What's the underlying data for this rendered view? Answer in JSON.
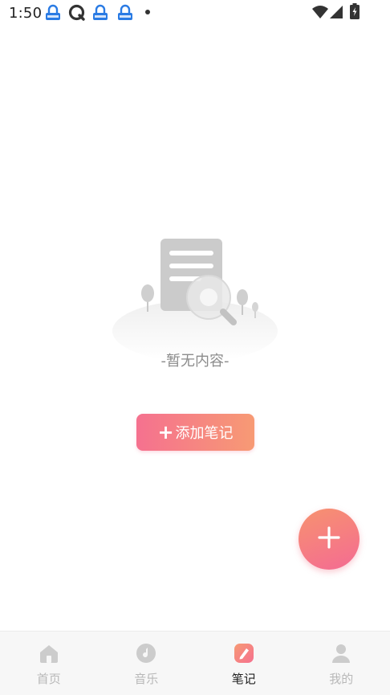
{
  "status_bar": {
    "time": "1:50",
    "notification_icons": [
      "lock-app-icon",
      "q-app-icon",
      "lock-app-icon",
      "lock-app-icon"
    ],
    "right_icons": [
      "wifi-icon",
      "signal-icon",
      "battery-charging-icon"
    ]
  },
  "empty_state": {
    "icon": "empty-document-search-illustration",
    "text": "-暂无内容-"
  },
  "add_note_button": {
    "label": "添加笔记",
    "icon": "plus-icon"
  },
  "fab": {
    "icon": "plus-icon"
  },
  "bottom_nav": {
    "items": [
      {
        "label": "首页",
        "icon": "home-icon",
        "active": false
      },
      {
        "label": "音乐",
        "icon": "music-disc-icon",
        "active": false
      },
      {
        "label": "笔记",
        "icon": "note-pencil-icon",
        "active": true
      },
      {
        "label": "我的",
        "icon": "user-icon",
        "active": false
      }
    ]
  },
  "colors": {
    "accent_start": "#f5718f",
    "accent_end": "#f79a74",
    "inactive_label": "#b8b8b8",
    "active_label": "#222222",
    "nav_background": "#f7f7f7"
  }
}
